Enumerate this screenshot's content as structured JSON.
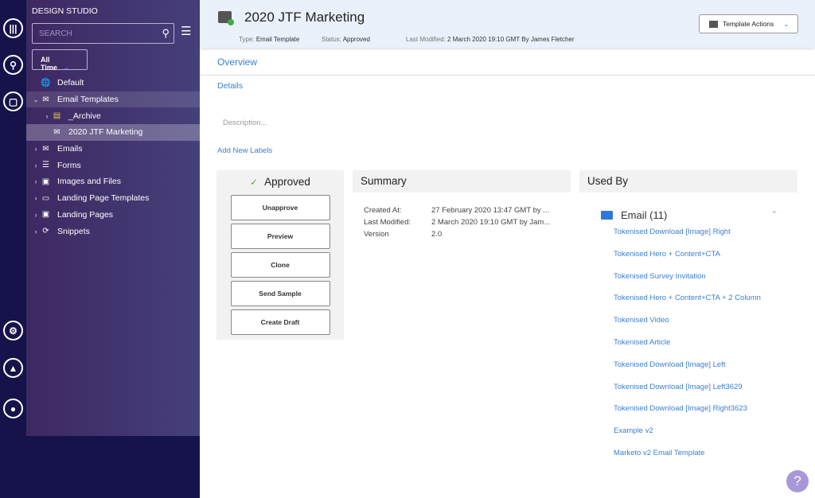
{
  "rail": {
    "icons": [
      "analytics-icon",
      "search-icon",
      "chat-icon",
      "gear-icon",
      "bell-icon",
      "user-icon"
    ]
  },
  "sidebar": {
    "title": "DESIGN STUDIO",
    "search_placeholder": "SEARCH",
    "filter": "All Time",
    "tree": [
      {
        "label": "Default",
        "icon": "globe-icon",
        "arrow": "",
        "indent": 0,
        "state": ""
      },
      {
        "label": "Email Templates",
        "icon": "email-template-icon",
        "arrow": "⌄",
        "indent": 0,
        "state": "sel1"
      },
      {
        "label": "_Archive",
        "icon": "archive-icon",
        "arrow": "›",
        "indent": 1,
        "state": ""
      },
      {
        "label": "2020 JTF Marketing",
        "icon": "email-template-approved-icon",
        "arrow": "",
        "indent": 1,
        "state": "sel2"
      },
      {
        "label": "Emails",
        "icon": "envelope-icon",
        "arrow": "›",
        "indent": 0,
        "state": ""
      },
      {
        "label": "Forms",
        "icon": "form-icon",
        "arrow": "›",
        "indent": 0,
        "state": ""
      },
      {
        "label": "Images and Files",
        "icon": "image-icon",
        "arrow": "›",
        "indent": 0,
        "state": ""
      },
      {
        "label": "Landing Page Templates",
        "icon": "landing-template-icon",
        "arrow": "›",
        "indent": 0,
        "state": ""
      },
      {
        "label": "Landing Pages",
        "icon": "landing-page-icon",
        "arrow": "›",
        "indent": 0,
        "state": ""
      },
      {
        "label": "Snippets",
        "icon": "snippet-icon",
        "arrow": "›",
        "indent": 0,
        "state": ""
      }
    ]
  },
  "header": {
    "title": "2020 JTF Marketing",
    "type_label": "Type:",
    "type_value": "Email Template",
    "status_label": "Status:",
    "status_value": "Approved",
    "modified_label": "Last Modified:",
    "modified_value": "2 March 2020 19:10 GMT By James Fletcher",
    "actions_label": "Template Actions"
  },
  "tabs": {
    "overview": "Overview",
    "details": "Details"
  },
  "description_placeholder": "Description...",
  "add_labels": "Add New Labels",
  "approval": {
    "status": "Approved",
    "buttons": [
      "Unapprove",
      "Preview",
      "Clone",
      "Send Sample",
      "Create Draft"
    ]
  },
  "summary": {
    "title": "Summary",
    "rows": [
      {
        "label": "Created At:",
        "value": "27 February 2020 13:47 GMT by ..."
      },
      {
        "label": "Last Modified:",
        "value": "2 March 2020 19:10 GMT by Jam..."
      },
      {
        "label": "Version",
        "value": "2.0"
      }
    ]
  },
  "used_by": {
    "title": "Used By",
    "group": "Email (11)",
    "items": [
      "Tokenised Download [Image] Right",
      "Tokenised Hero + Content+CTA",
      "Tokenised Survey Invitation",
      "Tokenised Hero + Content+CTA + 2 Column",
      "Tokenised Video",
      "Tokenised Article",
      "Tokenised Download [Image] Left",
      "Tokenised Download [Image] Left3629",
      "Tokenised Download [Image] Right3623",
      "Example v2",
      "Marketo v2 Email Template"
    ]
  },
  "colors": {
    "rail": "#16124a",
    "accent": "#3a7fd0",
    "approved": "#4caf50"
  }
}
